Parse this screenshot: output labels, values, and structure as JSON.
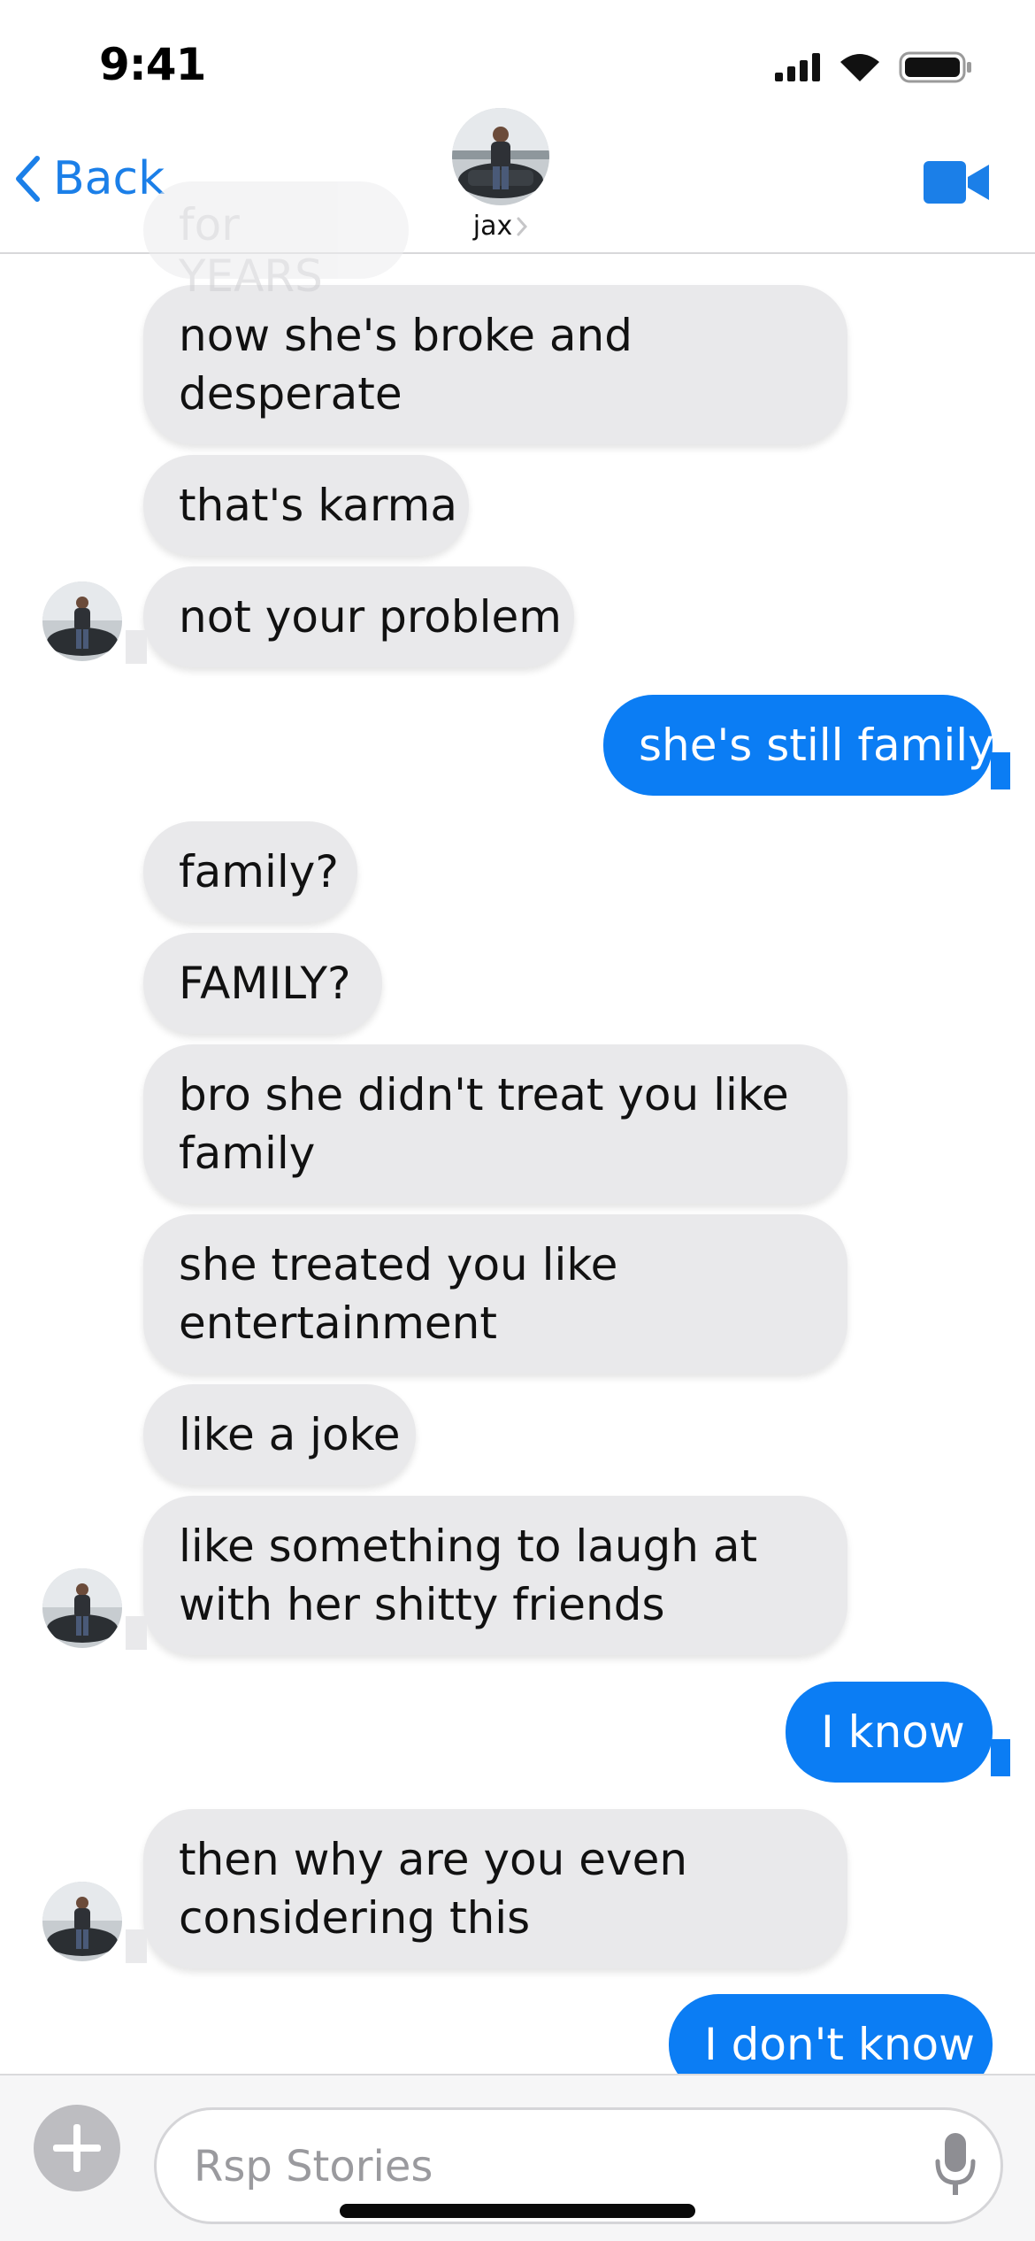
{
  "status_bar": {
    "time": "9:41",
    "icons": [
      "cellular-signal-icon",
      "wifi-icon",
      "battery-icon"
    ]
  },
  "header": {
    "back_label": "Back",
    "contact_name": "jax",
    "icons": [
      "chevron-left-icon",
      "chevron-right-icon",
      "video-camera-icon"
    ]
  },
  "colors": {
    "accent": "#1b7fe8",
    "outgoing_bubble": "#0b7df4",
    "incoming_bubble": "#e9e9eb"
  },
  "messages": [
    {
      "direction": "in",
      "text": "for YEARS"
    },
    {
      "direction": "in",
      "text": "now she's broke and\ndesperate"
    },
    {
      "direction": "in",
      "text": "that's karma"
    },
    {
      "direction": "in",
      "text": "not your problem"
    },
    {
      "direction": "out",
      "text": "she's still family"
    },
    {
      "direction": "in",
      "text": "family?"
    },
    {
      "direction": "in",
      "text": "FAMILY?"
    },
    {
      "direction": "in",
      "text": "bro she didn't treat you like\nfamily"
    },
    {
      "direction": "in",
      "text": "she treated you like\nentertainment"
    },
    {
      "direction": "in",
      "text": "like a joke"
    },
    {
      "direction": "in",
      "text": "like something to laugh at\nwith her shitty friends"
    },
    {
      "direction": "out",
      "text": "I know"
    },
    {
      "direction": "in",
      "text": "then why are you even\nconsidering this"
    },
    {
      "direction": "out",
      "text": "I don't know"
    }
  ],
  "composer": {
    "placeholder": "Rsp Stories",
    "icons": [
      "plus-icon",
      "microphone-icon"
    ]
  }
}
